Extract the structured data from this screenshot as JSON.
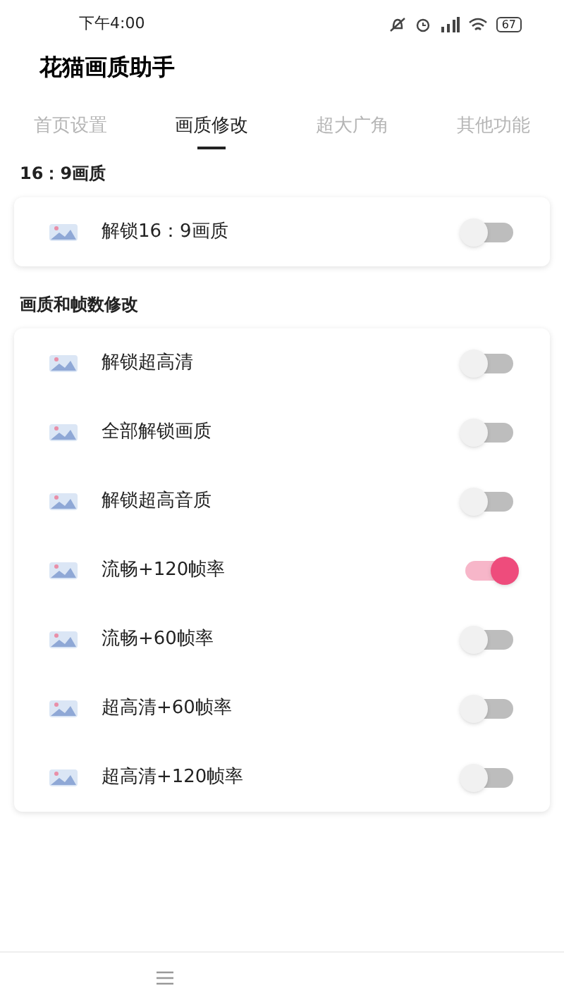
{
  "status_bar": {
    "time": "下午4:00",
    "battery": "67"
  },
  "title": "花猫画质助手",
  "tabs": [
    {
      "label": "首页设置",
      "selected": false
    },
    {
      "label": "画质修改",
      "selected": true
    },
    {
      "label": "超大广角",
      "selected": false
    },
    {
      "label": "其他功能",
      "selected": false
    }
  ],
  "sections": [
    {
      "heading": "16：9画质",
      "items": [
        {
          "label": "解锁16：9画质",
          "on": false
        }
      ]
    },
    {
      "heading": "画质和帧数修改",
      "items": [
        {
          "label": "解锁超高清",
          "on": false
        },
        {
          "label": "全部解锁画质",
          "on": false
        },
        {
          "label": "解锁超高音质",
          "on": false
        },
        {
          "label": "流畅+120帧率",
          "on": true
        },
        {
          "label": "流畅+60帧率",
          "on": false
        },
        {
          "label": "超高清+60帧率",
          "on": false
        },
        {
          "label": "超高清+120帧率",
          "on": false
        }
      ]
    }
  ]
}
